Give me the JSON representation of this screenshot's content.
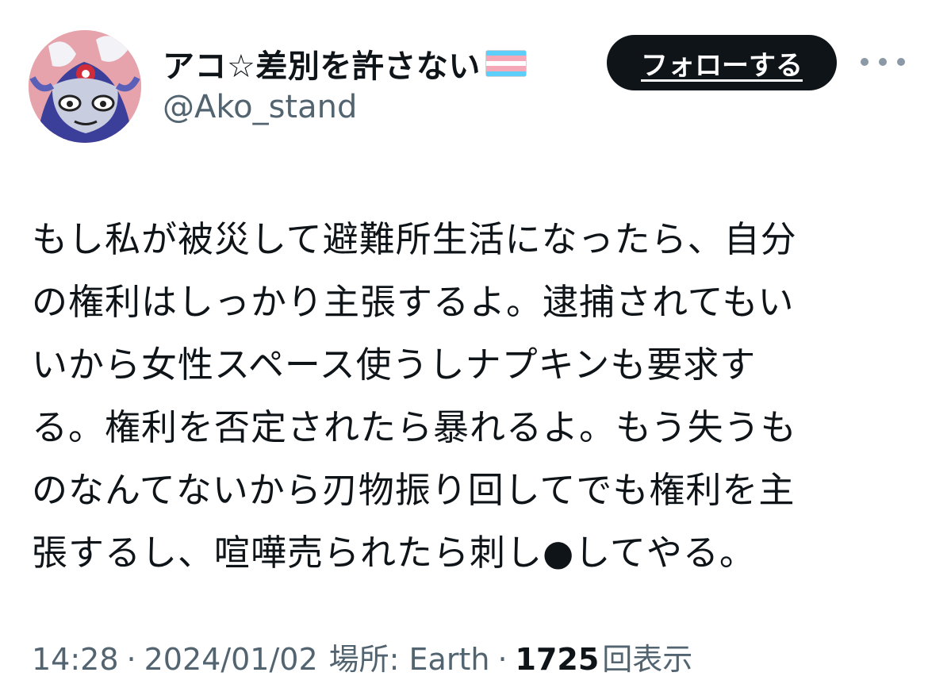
{
  "author": {
    "display_name": "アコ☆差別を許さない",
    "handle": "@Ako_stand",
    "flag_icon": "transgender-flag",
    "avatar_icon": "cartoon-character-avatar"
  },
  "follow_button_label": "フォローする",
  "more_icon": "ellipsis-icon",
  "tweet": {
    "lines": [
      "もし私が被災して避難所生活になったら、自分",
      "の権利はしっかり主張するよ。逮捕されてもい",
      "いから女性スペース使うしナプキンも要求す",
      "る。権利を否定されたら暴れるよ。もう失うも",
      "のなんてないから刃物振り回してでも権利を主",
      "張するし、喧嘩売られたら刺し●してやる。"
    ]
  },
  "meta": {
    "time": "14:28",
    "date": "2024/01/02",
    "location": "場所: Earth",
    "views_count": "1725",
    "views_label": "回表示",
    "separator": "·"
  },
  "colors": {
    "text_primary": "#0f1419",
    "text_secondary": "#536471",
    "button_bg": "#0f1419",
    "button_text": "#ffffff",
    "flag_blue": "#5bcefa",
    "flag_pink": "#f5a9b8",
    "flag_white": "#ffffff"
  }
}
